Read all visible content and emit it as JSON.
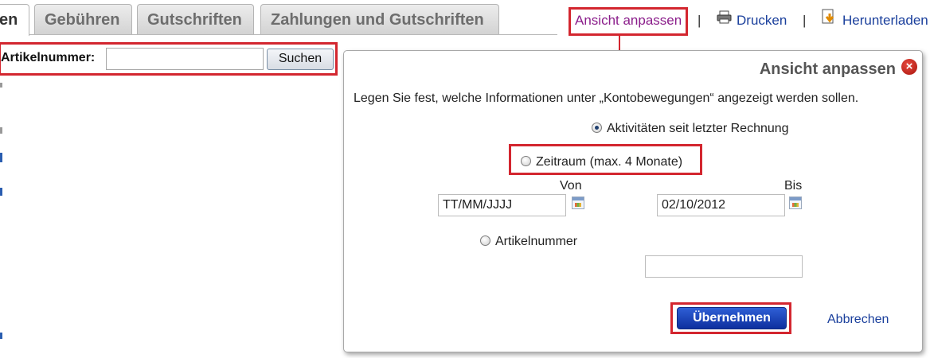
{
  "tabs": [
    {
      "label": "en",
      "active": true
    },
    {
      "label": "Gebühren",
      "active": false
    },
    {
      "label": "Gutschriften",
      "active": false
    },
    {
      "label": "Zahlungen und Gutschriften",
      "active": false
    }
  ],
  "toolbar": {
    "customize_view": "Ansicht anpassen",
    "separator": "|",
    "print": "Drucken",
    "download": "Herunterladen"
  },
  "search": {
    "label": "Artikelnummer:",
    "value": "",
    "button": "Suchen"
  },
  "dialog": {
    "title": "Ansicht anpassen",
    "close_glyph": "×",
    "description": "Legen Sie fest, welche Informationen unter „Kontobewegungen“ angezeigt werden sollen.",
    "options": {
      "since_last_invoice": {
        "label": "Aktivitäten seit letzter Rechnung",
        "checked": true
      },
      "date_range": {
        "label": "Zeitraum (max. 4 Monate)",
        "checked": false
      },
      "item_number": {
        "label": "Artikelnummer",
        "checked": false
      }
    },
    "from_label": "Von",
    "to_label": "Bis",
    "from_value": "TT/MM/JJJJ",
    "to_value": "02/10/2012",
    "item_number_value": "",
    "apply_button": "Übernehmen",
    "cancel_link": "Abbrechen"
  },
  "colors": {
    "highlight_red": "#d3262f",
    "link_blue": "#1a3f9c",
    "link_visited": "#8b1e8b",
    "apply_button": "#1a3fb0"
  }
}
